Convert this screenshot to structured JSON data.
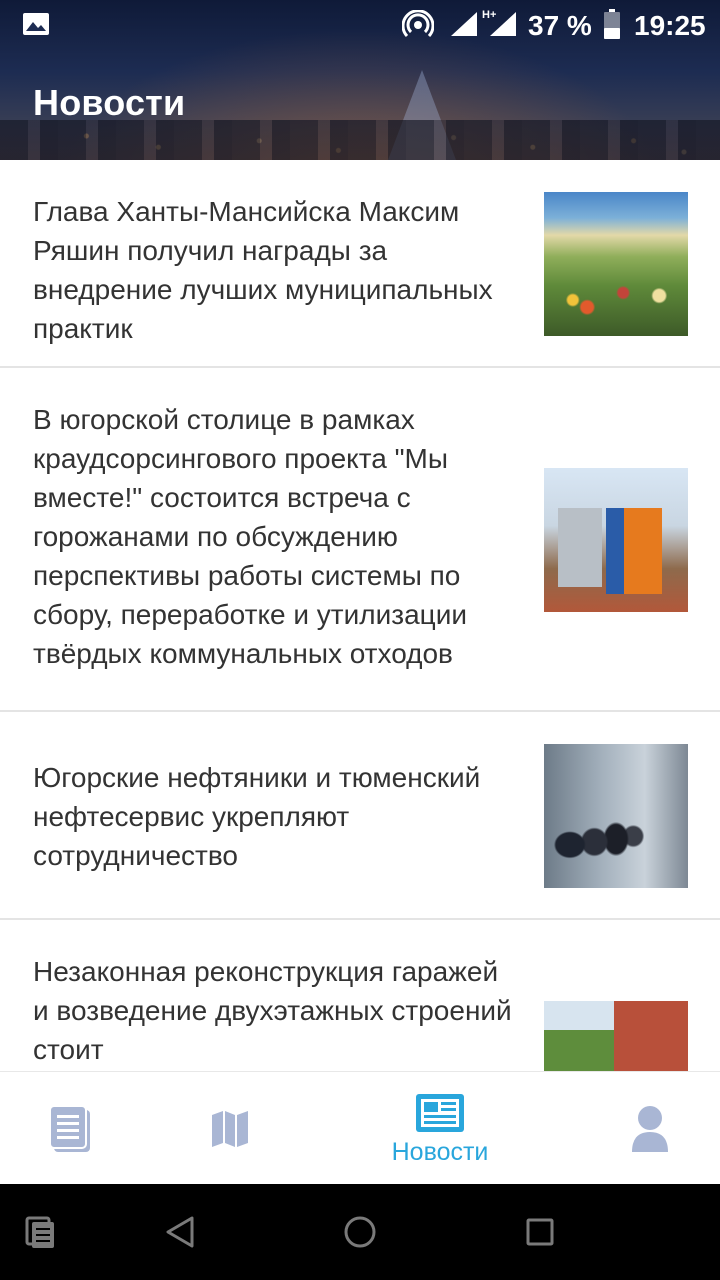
{
  "status_bar": {
    "battery_percent": "37 %",
    "time": "19:25",
    "network_type": "H+",
    "icons": [
      "gallery-icon",
      "hotspot-icon",
      "signal-icon",
      "signal-icon",
      "battery-icon"
    ]
  },
  "header": {
    "title": "Новости"
  },
  "news": [
    {
      "title": "Глава Ханты-Мансийска Максим Ряшин получил награды за внедрение лучших муниципальных практик",
      "thumbnail": "city-aerial"
    },
    {
      "title": "В югорской столице в рамках краудсорсингового проекта \"Мы вместе!\" состоится встреча с горожанами по обсуждению перспективы работы системы по сбору, переработке и утилизации твёрдых коммунальных отходов",
      "thumbnail": "recycling-containers"
    },
    {
      "title": "Югорские нефтяники и тюменский нефтесервис укрепляют сотрудничество",
      "thumbnail": "factory-visit"
    },
    {
      "title": "Незаконная реконструкция гаражей и возведение двухэтажных строений стоит",
      "thumbnail": "houses"
    }
  ],
  "bottom_nav": {
    "active_color": "#29a6dc",
    "inactive_color": "#a9b6d4",
    "items": [
      {
        "icon": "documents-icon",
        "label": ""
      },
      {
        "icon": "map-icon",
        "label": ""
      },
      {
        "icon": "newspaper-icon",
        "label": "Новости",
        "active": true
      },
      {
        "icon": "profile-icon",
        "label": ""
      }
    ]
  },
  "system_nav": {
    "icons": [
      "recent-docs-icon",
      "back-icon",
      "home-icon",
      "overview-icon"
    ]
  }
}
